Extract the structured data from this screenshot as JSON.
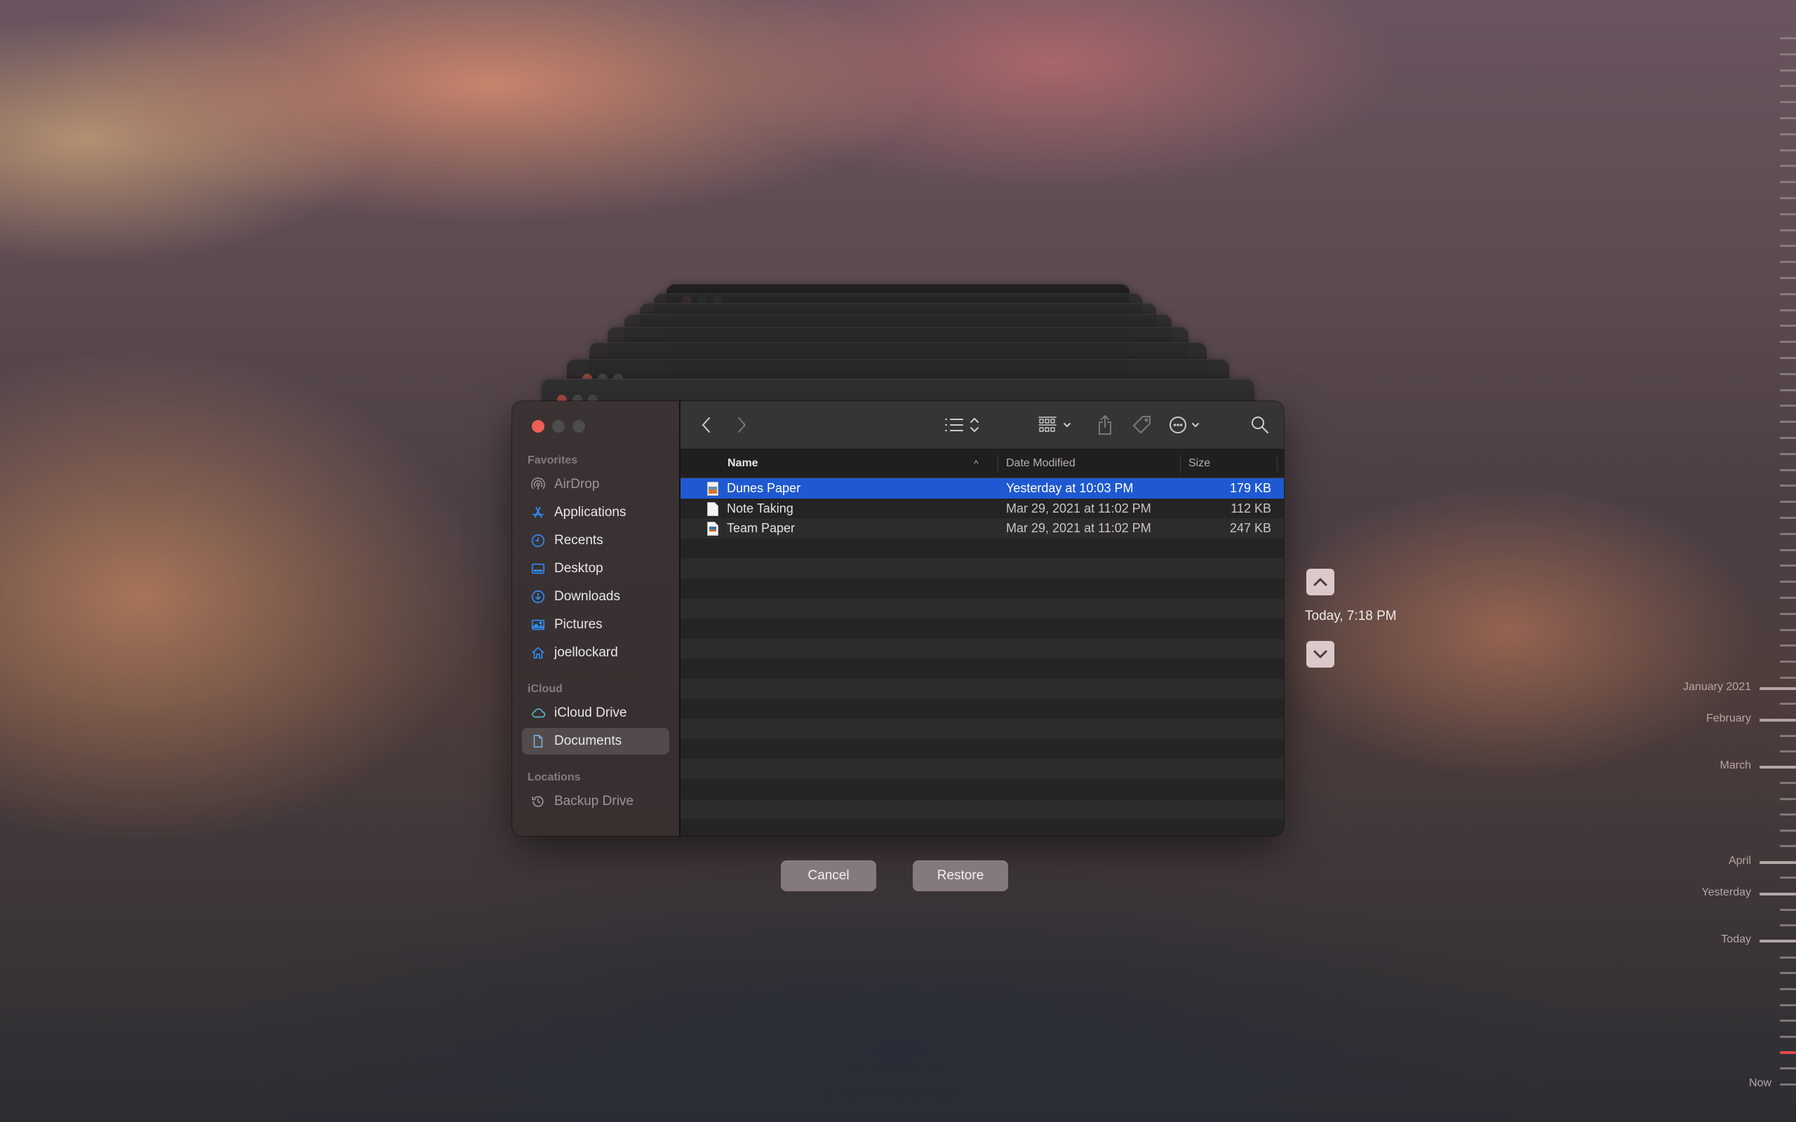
{
  "window": {
    "sidebar": {
      "sections": [
        {
          "label": "Favorites",
          "items": [
            {
              "label": "AirDrop",
              "icon": "airdrop-icon",
              "enabled": false
            },
            {
              "label": "Applications",
              "icon": "applications-icon",
              "enabled": true
            },
            {
              "label": "Recents",
              "icon": "clock-icon",
              "enabled": true
            },
            {
              "label": "Desktop",
              "icon": "desktop-icon",
              "enabled": true
            },
            {
              "label": "Downloads",
              "icon": "download-icon",
              "enabled": true
            },
            {
              "label": "Pictures",
              "icon": "pictures-icon",
              "enabled": true
            },
            {
              "label": "joellockard",
              "icon": "home-icon",
              "enabled": true
            }
          ]
        },
        {
          "label": "iCloud",
          "items": [
            {
              "label": "iCloud Drive",
              "icon": "cloud-icon",
              "enabled": true
            },
            {
              "label": "Documents",
              "icon": "document-icon",
              "enabled": true,
              "selected": true
            }
          ]
        },
        {
          "label": "Locations",
          "items": [
            {
              "label": "Backup Drive",
              "icon": "time-machine-icon",
              "enabled": false
            }
          ]
        }
      ]
    },
    "toolbar": {
      "back": "chevron-left-icon",
      "forward": "chevron-right-icon",
      "view_options": "list-view-icon",
      "group": "grid-group-icon",
      "share": "share-icon",
      "tag": "tag-icon",
      "more": "ellipsis-circle-icon",
      "search": "search-icon"
    },
    "columns": {
      "name": "Name",
      "date": "Date Modified",
      "size": "Size"
    },
    "files": [
      {
        "name": "Dunes Paper",
        "date": "Yesterday at 10:03 PM",
        "size": "179 KB",
        "selected": true
      },
      {
        "name": "Note Taking",
        "date": "Mar 29, 2021 at 11:02 PM",
        "size": "112 KB",
        "selected": false
      },
      {
        "name": "Team Paper",
        "date": "Mar 29, 2021 at 11:02 PM",
        "size": "247 KB",
        "selected": false
      }
    ]
  },
  "buttons": {
    "cancel": "Cancel",
    "restore": "Restore"
  },
  "snapshot": {
    "label": "Today, 7:18 PM"
  },
  "timeline": {
    "labels": [
      "January 2021",
      "February",
      "March",
      "April",
      "Yesterday",
      "Today",
      "Now"
    ],
    "accent_color": "#e04a48"
  },
  "colors": {
    "selection": "#1f59d2",
    "close_button": "#ee5e56"
  }
}
